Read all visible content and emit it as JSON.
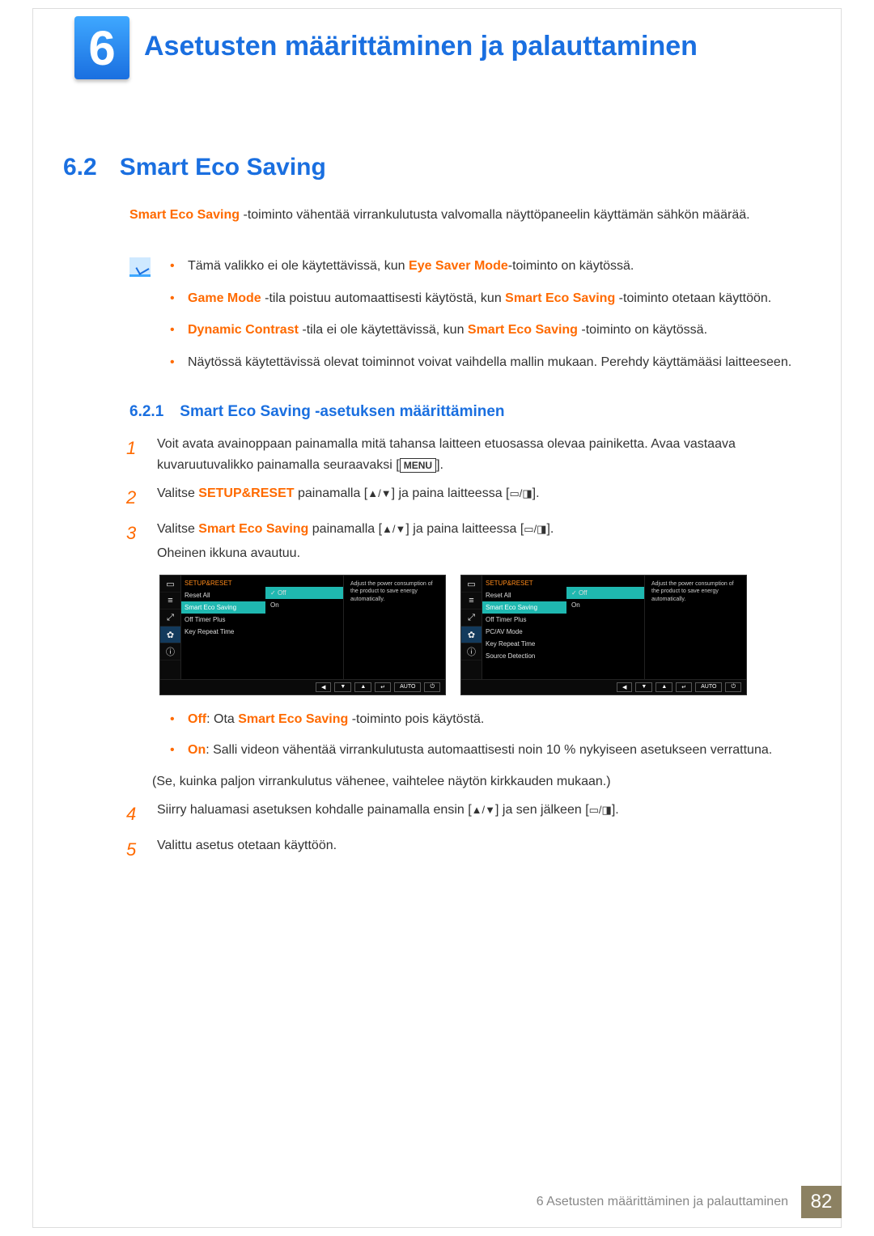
{
  "chapter": {
    "number": "6",
    "title": "Asetusten määrittäminen ja palauttaminen"
  },
  "section": {
    "number": "6.2",
    "title": "Smart Eco Saving"
  },
  "intro": {
    "prefix": "Smart Eco Saving",
    "rest": " -toiminto vähentää virrankulutusta valvomalla näyttöpaneelin käyttämän sähkön määrää."
  },
  "notes": {
    "n1a": "Tämä valikko ei ole käytettävissä, kun ",
    "n1b": "Eye Saver Mode",
    "n1c": "-toiminto on käytössä.",
    "n2a": "Game Mode",
    "n2b": " -tila poistuu automaattisesti käytöstä, kun ",
    "n2c": "Smart Eco Saving",
    "n2d": " -toiminto otetaan käyttöön.",
    "n3a": "Dynamic Contrast",
    "n3b": " -tila ei ole käytettävissä, kun ",
    "n3c": "Smart Eco Saving",
    "n3d": " -toiminto on käytössä.",
    "n4": "Näytössä käytettävissä olevat toiminnot voivat vaihdella mallin mukaan. Perehdy käyttämääsi laitteeseen."
  },
  "subsection": {
    "number": "6.2.1",
    "title": "Smart Eco Saving -asetuksen määrittäminen"
  },
  "steps": {
    "s1": "Voit avata avainoppaan painamalla mitä tahansa laitteen etuosassa olevaa painiketta. Avaa vastaava kuvaruutuvalikko painamalla seuraavaksi [",
    "menu": "MENU",
    "s1end": "].",
    "s2a": "Valitse ",
    "s2b": "SETUP&RESET",
    "s2c": " painamalla [",
    "updown": "▲/▼",
    "s2d": "] ja paina laitteessa [",
    "rectpip": "▭/◨",
    "s2e": "].",
    "s3a": "Valitse ",
    "s3b": "Smart Eco Saving",
    "s3c": " painamalla [",
    "s3d": "] ja paina laitteessa [",
    "s3e": "].",
    "s3f": "Oheinen ikkuna avautuu.",
    "s4a": "Siirry haluamasi asetuksen kohdalle painamalla ensin [",
    "s4b": "] ja sen jälkeen [",
    "s4c": "].",
    "s5": "Valittu asetus otetaan käyttöön."
  },
  "osd": {
    "title": "SETUP&RESET",
    "desc": "Adjust the power consumption of the product to save energy automatically.",
    "items1": [
      "Reset All",
      "Smart Eco Saving",
      "Off Timer Plus",
      "Key Repeat Time"
    ],
    "items2": [
      "Reset All",
      "Smart Eco Saving",
      "Off Timer Plus",
      "PC/AV Mode",
      "Key Repeat Time",
      "Source Detection"
    ],
    "sub": {
      "off": "Off",
      "on": "On"
    },
    "nav": {
      "left": "◀",
      "down": "▼",
      "up": "▲",
      "enter": "↵",
      "auto": "AUTO",
      "power": "⏻"
    }
  },
  "post": {
    "offLabel": "Off",
    "offText": ": Ota ",
    "offBold": "Smart Eco Saving",
    "offRest": " -toiminto pois käytöstä.",
    "onLabel": "On",
    "onText": ": Salli videon vähentää virrankulutusta automaattisesti noin 10 % nykyiseen asetukseen verrattuna.",
    "paren": "(Se, kuinka paljon virrankulutus vähenee, vaihtelee näytön kirkkauden mukaan.)"
  },
  "footer": {
    "text": "6 Asetusten määrittäminen ja palauttaminen",
    "page": "82"
  }
}
